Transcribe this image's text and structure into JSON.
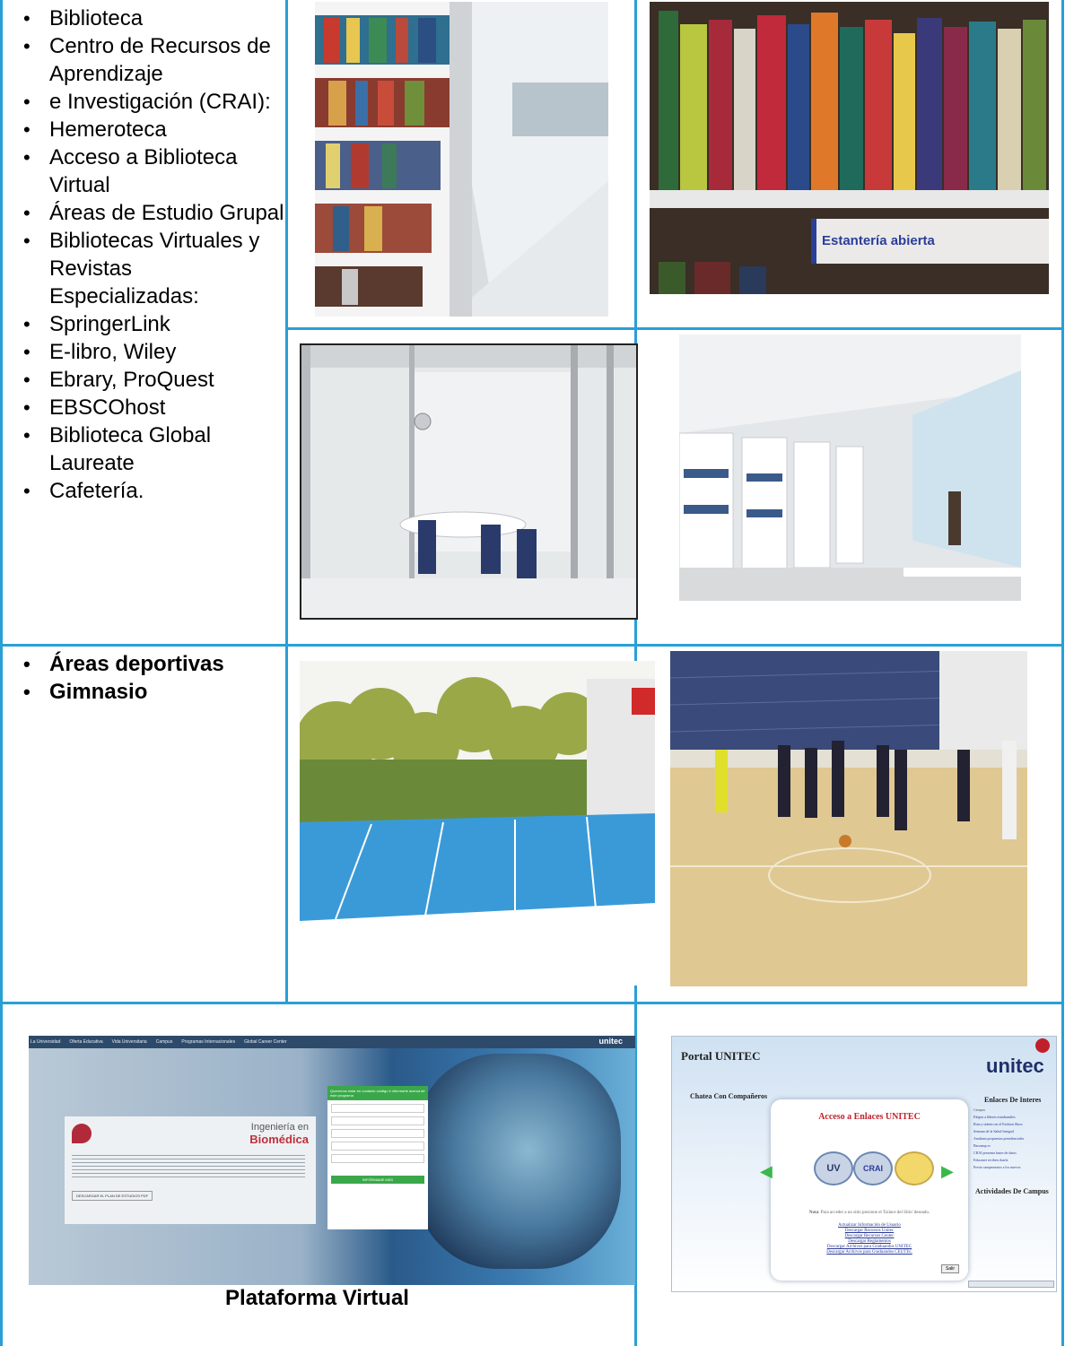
{
  "facilities_list": [
    "Biblioteca",
    "Centro de Recursos de Aprendizaje",
    "e Investigación (CRAI):",
    "Hemeroteca",
    "Acceso a Biblioteca Virtual",
    "Áreas de Estudio Grupal",
    "Bibliotecas Virtuales y Revistas Especializadas:",
    "SpringerLink",
    "E-libro, Wiley",
    "Ebrary, ProQuest",
    "EBSCOhost",
    "Biblioteca Global Laureate",
    "Cafetería."
  ],
  "sports_list": [
    "Áreas deportivas",
    "Gimnasio"
  ],
  "photo2_sign": "Estantería abierta",
  "virtual_caption": "Plataforma Virtual",
  "website": {
    "nav": [
      "La Universidad",
      "Oferta Educativa",
      "Vida Universitaria",
      "Campus",
      "Programas Internacionales",
      "Global Career Center"
    ],
    "brand": "unitec",
    "program_small": "Ingeniería en",
    "program_big": "Biomédica",
    "form_title": "Queremos estar en contacto contigo e informarte acerca de este programa",
    "form_button": "INFÓRMAME MÁS",
    "download_button": "DESCARGAR EL PLAN DE ESTUDIOS PDF"
  },
  "portal": {
    "title": "Portal UNITEC",
    "logo": "unitec",
    "chat": "Chatea Con Compañeros",
    "links_header": "Enlaces De Interes",
    "campus_label": "Campus",
    "links": [
      "Elegen a líderes estudiantiles",
      "Ruta y talento en el Fashion Show",
      "Semana de la Salud Integral",
      "Analizan propuestas presidenciales",
      "Baroamp ec",
      "CRAI presenta bases de datos",
      "Educanet reciben charla",
      "Presta campeonatos a los nuevos"
    ],
    "activities": "Actividades De Campus",
    "access_title": "Acceso a Enlaces UNITEC",
    "icon_labels": [
      "UV",
      "CRAI"
    ],
    "note_bold": "Nota",
    "note": ": Para acceder a un sitio presione el 'Enlace del Sitio' deseado.",
    "downloads": [
      "Actualizar Información de Usuario",
      "Descargar Recursos Unitec",
      "Descargar Recursos Ceutec",
      "Descargar Reglamentos",
      "Descargar Archivos para Graduandos UNITEC",
      "Descargar Archivos para Graduandos CEUTEC"
    ],
    "exit": "Salir"
  }
}
